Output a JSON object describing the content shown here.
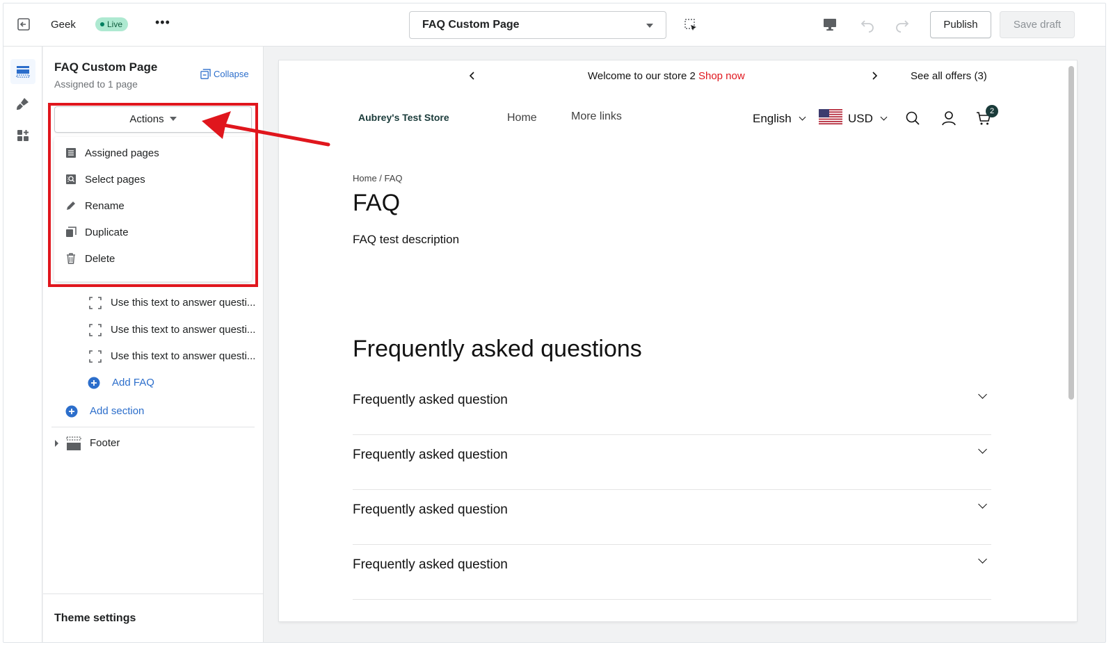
{
  "topbar": {
    "store_name": "Geek",
    "live_badge": "Live",
    "more_label": "•••",
    "page_select": "FAQ Custom Page",
    "publish_label": "Publish",
    "save_label": "Save draft"
  },
  "sidebar": {
    "title": "FAQ Custom Page",
    "subtitle": "Assigned to 1 page",
    "collapse_label": "Collapse",
    "actions_label": "Actions",
    "menu": [
      {
        "label": "Assigned pages",
        "icon": "list-icon"
      },
      {
        "label": "Select pages",
        "icon": "search-pages-icon"
      },
      {
        "label": "Rename",
        "icon": "pencil-icon"
      },
      {
        "label": "Duplicate",
        "icon": "duplicate-icon"
      },
      {
        "label": "Delete",
        "icon": "trash-icon"
      }
    ],
    "faq_blocks": [
      "Use this text to answer questi...",
      "Use this text to answer questi...",
      "Use this text to answer questi..."
    ],
    "add_faq": "Add FAQ",
    "add_section": "Add section",
    "footer": "Footer",
    "theme_settings": "Theme settings"
  },
  "preview": {
    "announcement": "Welcome to our store 2",
    "announcement_link": "Shop now",
    "offers": "See all offers (3)",
    "store_logo": "Aubrey's Test Store",
    "nav": [
      "Home",
      "More links"
    ],
    "language": "English",
    "currency": "USD",
    "cart_count": "2",
    "breadcrumb": "Home / FAQ",
    "page_title": "FAQ",
    "page_description": "FAQ test description",
    "faq_heading": "Frequently asked questions",
    "questions": [
      "Frequently asked question",
      "Frequently asked question",
      "Frequently asked question",
      "Frequently asked question"
    ]
  },
  "colors": {
    "accent_blue": "#2c6ecb",
    "annotation_red": "#e0161d",
    "live_green": "#aee9d1",
    "store_teal": "#1a3b3a"
  }
}
